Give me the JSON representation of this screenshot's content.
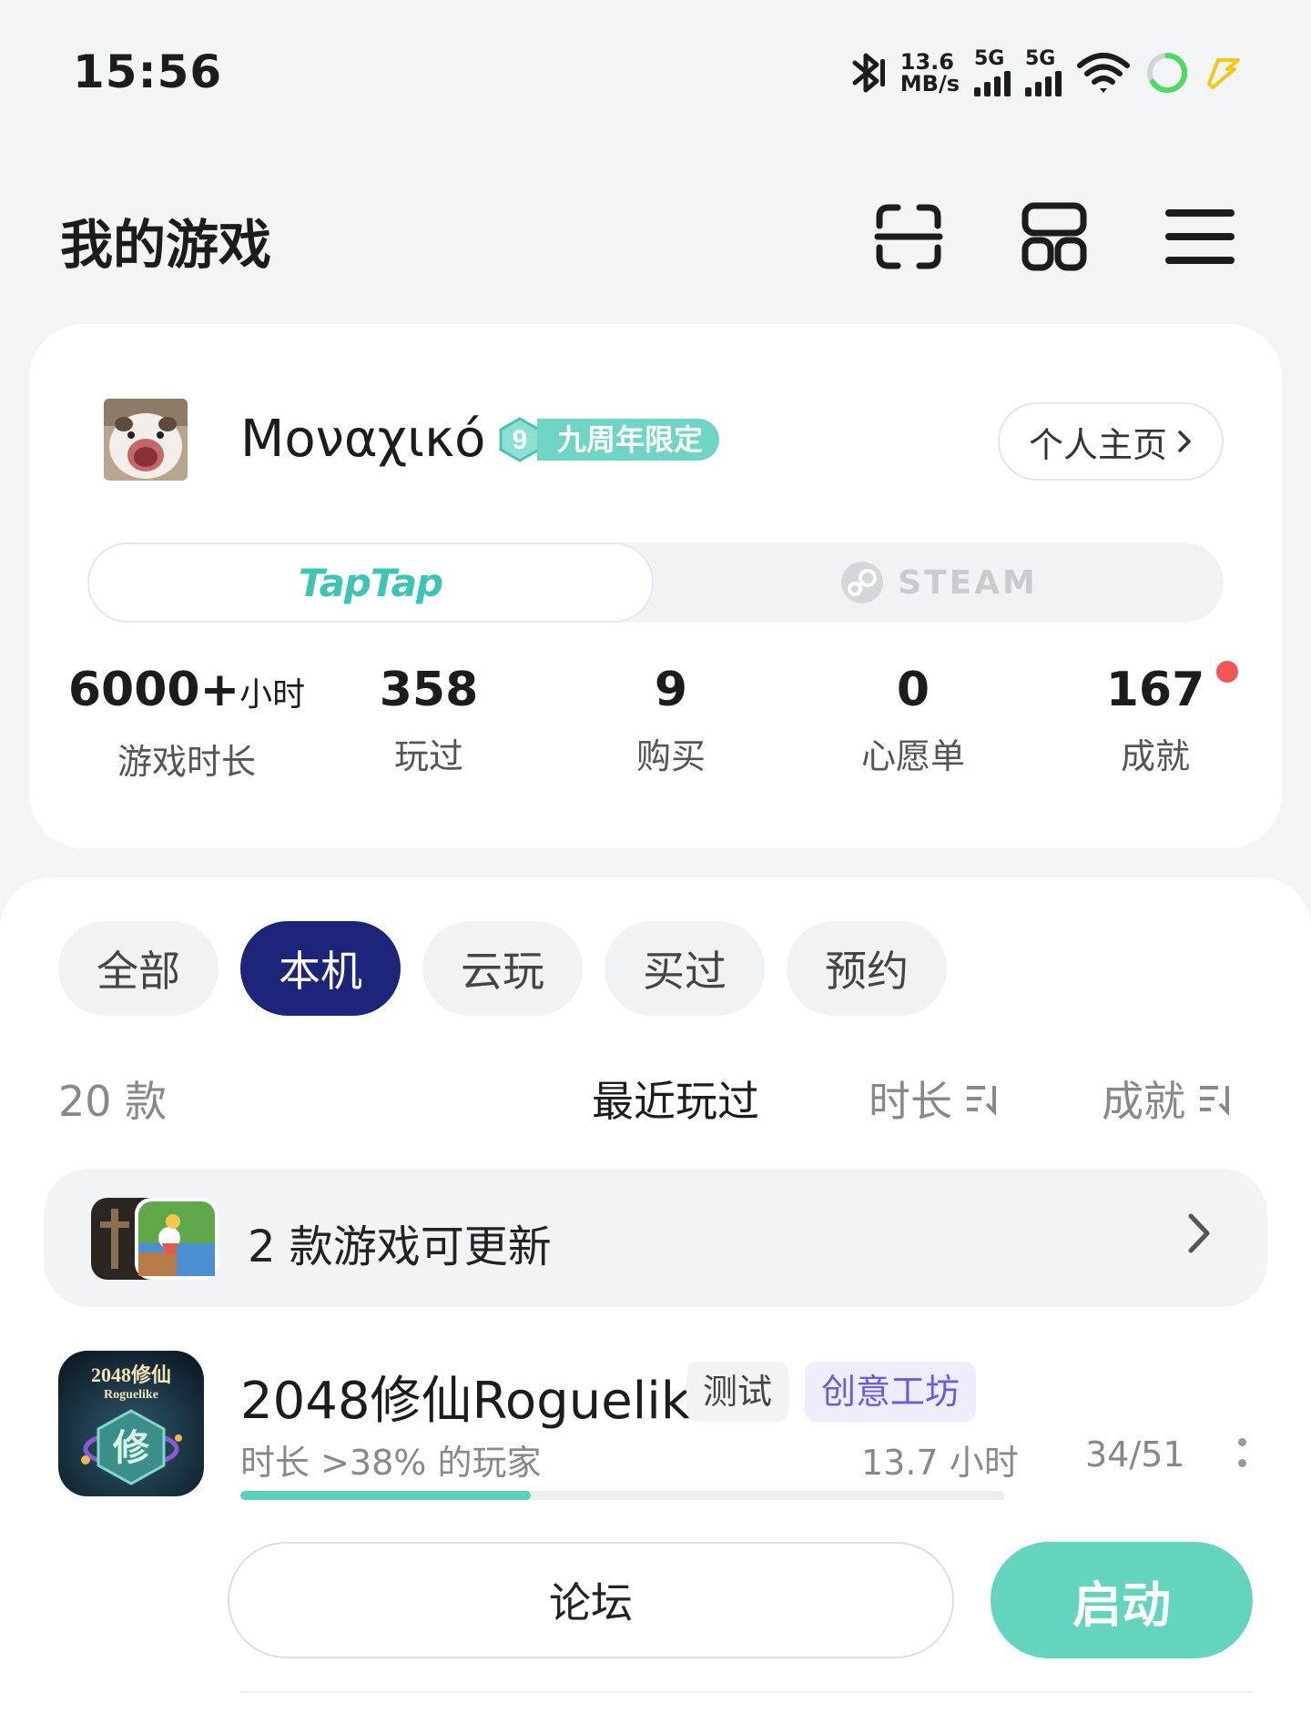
{
  "status_bar": {
    "time": "15:56",
    "net_speed_value": "13.6",
    "net_speed_unit": "MB/s",
    "signal1": "5G",
    "signal2": "5G",
    "icons": [
      "bluetooth-icon",
      "signal-icon",
      "signal-icon",
      "wifi-icon",
      "battery-ring-icon",
      "charging-bolt-icon"
    ],
    "colors": {
      "charging": "#f5c518",
      "battery_ring": "#4cd964"
    }
  },
  "header": {
    "title": "我的游戏",
    "icons": [
      "scan-icon",
      "grid-icon",
      "menu-icon"
    ]
  },
  "profile": {
    "username": "Μοναχικό",
    "badge_number": "9",
    "badge_label": "九周年限定",
    "profile_link": "个人主页",
    "platforms": {
      "active": "TapTap",
      "inactive": "STEAM"
    },
    "stats": [
      {
        "value": "6000+",
        "unit": "小时",
        "label": "游戏时长"
      },
      {
        "value": "358",
        "unit": "",
        "label": "玩过"
      },
      {
        "value": "9",
        "unit": "",
        "label": "购买"
      },
      {
        "value": "0",
        "unit": "",
        "label": "心愿单"
      },
      {
        "value": "167",
        "unit": "",
        "label": "成就"
      }
    ]
  },
  "filters": {
    "tabs": [
      "全部",
      "本机",
      "云玩",
      "买过",
      "预约"
    ],
    "active": "本机"
  },
  "sort": {
    "count": "20 款",
    "recent": "最近玩过",
    "duration": "时长",
    "achievement": "成就"
  },
  "update_bar": {
    "text": "2 款游戏可更新"
  },
  "games": [
    {
      "title": "2048修仙Roguelik",
      "tags": [
        "测试",
        "创意工坊"
      ],
      "subtitle": "时长 >38% 的玩家",
      "hours": "13.7 小时",
      "achievements": "34/51",
      "progress_fraction": 0.38,
      "icon_text_line1": "2048修仙",
      "icon_text_line2": "Roguelike",
      "icon_glyph": "修",
      "forum_label": "论坛",
      "launch_label": "启动"
    }
  ],
  "colors": {
    "accent": "#64d4bf",
    "active_tab": "#1c2579",
    "tag_purple": "#6a5ce0",
    "badge": "#6fd4c4",
    "notification_dot": "#f25757"
  }
}
